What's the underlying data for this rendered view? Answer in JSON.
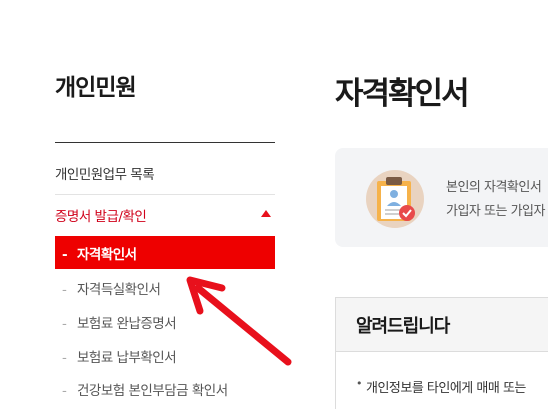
{
  "sidebar": {
    "title": "개인민원",
    "items": [
      {
        "label": "개인민원업무 목록"
      },
      {
        "label": "증명서 발급/확인"
      }
    ],
    "sub_items": [
      {
        "label": "자격확인서",
        "active": true
      },
      {
        "label": "자격득실확인서"
      },
      {
        "label": "보험료 완납증명서"
      },
      {
        "label": "보험료 납부확인서"
      },
      {
        "label": "건강보험 본인부담금 확인서"
      }
    ],
    "dash": "-"
  },
  "main": {
    "title": "자격확인서",
    "info": {
      "line1": "본인의 자격확인서",
      "line2": "가입자 또는 가입자"
    },
    "notice": {
      "title": "알려드립니다",
      "line1": "개인정보를 타인에게 매매 또는"
    }
  },
  "colors": {
    "accent_red": "#ee0000",
    "menu_red": "#d0021b",
    "arrow_red": "#e8101c"
  }
}
